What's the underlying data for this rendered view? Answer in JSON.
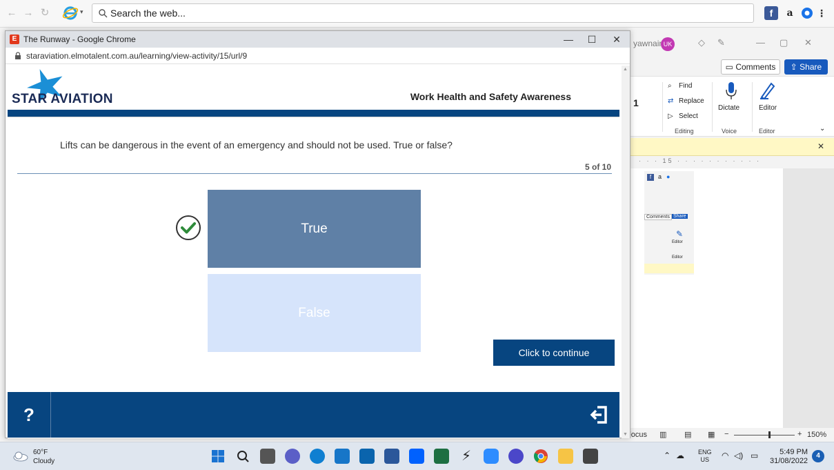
{
  "outer_browser": {
    "search_placeholder": "Search the web..."
  },
  "word": {
    "user_name": "yawnaing",
    "user_initials": "UK",
    "comments_label": "Comments",
    "share_label": "Share",
    "find_label": "Find",
    "replace_label": "Replace",
    "select_label": "Select",
    "dictate_label": "Dictate",
    "editor_label": "Editor",
    "group_editing": "Editing",
    "group_voice": "Voice",
    "group_editor": "Editor",
    "font_size_partial": "1",
    "ruler_mark": "15",
    "focus_label": "Focus",
    "zoom_label": "150%",
    "mini_comments": "Comments",
    "mini_share": "Share",
    "mini_editor": "Editor",
    "mini_group_editor": "Editor"
  },
  "popup": {
    "window_title": "The Runway - Google Chrome",
    "site_icon_letter": "E",
    "url": "staraviation.elmotalent.com.au/learning/view-activity/15/url/9"
  },
  "course": {
    "logo_text": "STAR AVIATION",
    "title": "Work Health and Safety Awareness",
    "question": "Lifts can be dangerous in the event of an emergency and should not be used. True or false?",
    "progress_text": "5 of 10",
    "options": [
      {
        "label": "True",
        "selected": true
      },
      {
        "label": "False",
        "selected": false
      }
    ],
    "continue_label": "Click to continue",
    "help_label": "?"
  },
  "taskbar": {
    "weather_temp": "60°F",
    "weather_desc": "Cloudy",
    "language": "ENG",
    "region": "US",
    "time": "5:49 PM",
    "date": "31/08/2022",
    "notification_count": "4"
  },
  "colors": {
    "brand_blue": "#074580",
    "option_selected": "#5f80a6",
    "option_unselected": "#d6e4fb",
    "check_green": "#2e8b3a",
    "word_share": "#185abd"
  }
}
